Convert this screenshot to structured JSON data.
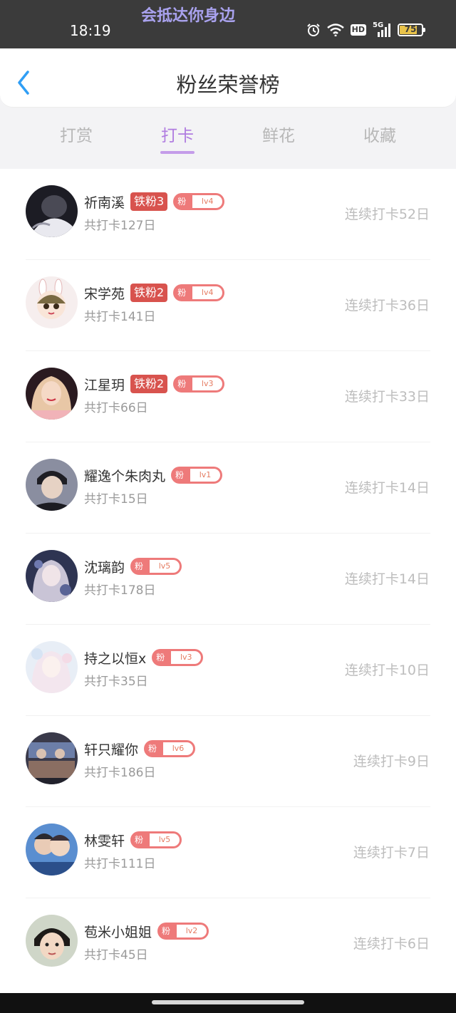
{
  "status_bar": {
    "time": "18:19",
    "overlay_title": "会抵达你身边",
    "hd": "HD",
    "network": "5G",
    "battery": "75"
  },
  "header": {
    "title": "粉丝荣誉榜"
  },
  "tabs": [
    {
      "label": "打赏",
      "active": false
    },
    {
      "label": "打卡",
      "active": true
    },
    {
      "label": "鲜花",
      "active": false
    },
    {
      "label": "收藏",
      "active": false
    }
  ],
  "fan_badge_prefix": "粉",
  "users": [
    {
      "name": "祈南溪",
      "tie": "铁粉3",
      "level": "lv4",
      "total": "共打卡127日",
      "streak": "连续打卡52日"
    },
    {
      "name": "宋学苑",
      "tie": "铁粉2",
      "level": "lv4",
      "total": "共打卡141日",
      "streak": "连续打卡36日"
    },
    {
      "name": "江星玥",
      "tie": "铁粉2",
      "level": "lv3",
      "total": "共打卡66日",
      "streak": "连续打卡33日"
    },
    {
      "name": "耀逸个朱肉丸",
      "tie": null,
      "level": "lv1",
      "total": "共打卡15日",
      "streak": "连续打卡14日"
    },
    {
      "name": "沈璃韵",
      "tie": null,
      "level": "lv5",
      "total": "共打卡178日",
      "streak": "连续打卡14日"
    },
    {
      "name": "持之以恒x",
      "tie": null,
      "level": "lv3",
      "total": "共打卡35日",
      "streak": "连续打卡10日"
    },
    {
      "name": "轩只耀你",
      "tie": null,
      "level": "lv6",
      "total": "共打卡186日",
      "streak": "连续打卡9日"
    },
    {
      "name": "林雯轩",
      "tie": null,
      "level": "lv5",
      "total": "共打卡111日",
      "streak": "连续打卡7日"
    },
    {
      "name": "苞米小姐姐",
      "tie": null,
      "level": "lv2",
      "total": "共打卡45日",
      "streak": "连续打卡6日"
    }
  ],
  "colors": {
    "accent": "#b07ce0",
    "tie_badge": "#d8534e",
    "fan_badge": "#ee7a7a",
    "muted": "#bdbdbd"
  }
}
